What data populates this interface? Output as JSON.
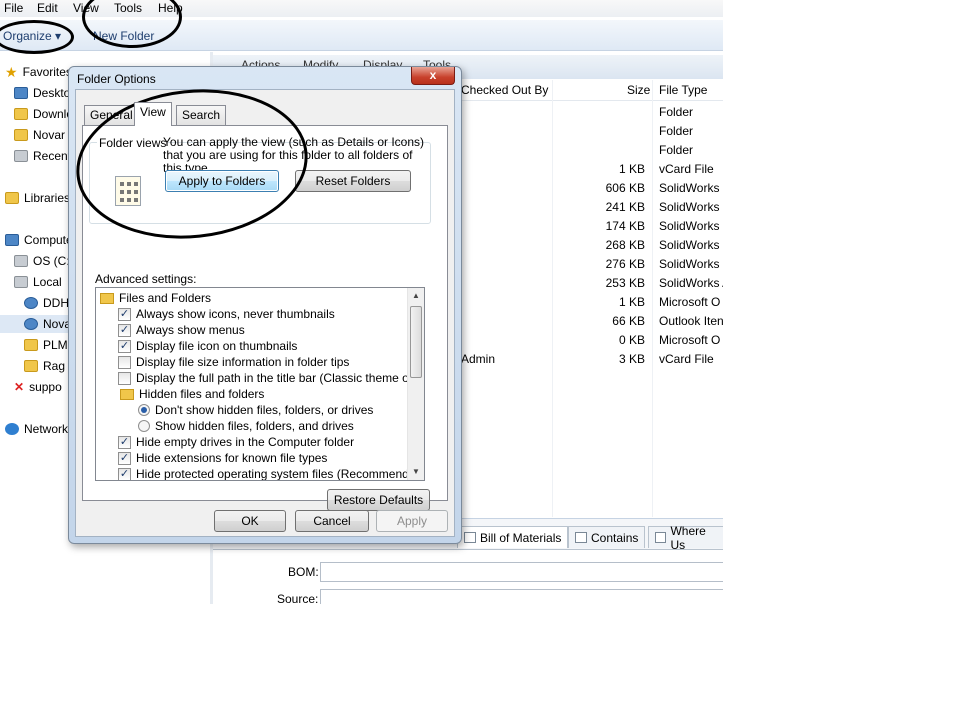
{
  "menubar": {
    "items": [
      "File",
      "Edit",
      "View",
      "Tools",
      "Help"
    ]
  },
  "cmdbar": {
    "organize": "Organize",
    "new_folder": "New Folder"
  },
  "toolbar2": {
    "items": [
      "Actions",
      "Modify",
      "Display",
      "Tools"
    ]
  },
  "navpane": {
    "items": [
      {
        "label": "Favorites",
        "icon": "star-icon"
      },
      {
        "label": "Desktop",
        "icon": "desktop-icon"
      },
      {
        "label": "Downloads",
        "icon": "folder-icon"
      },
      {
        "label": "Novar",
        "icon": "folder-icon"
      },
      {
        "label": "Recent",
        "icon": "recent-places-icon"
      },
      {
        "label": "Libraries",
        "icon": "library-icon"
      },
      {
        "label": "Computer",
        "icon": "computer-icon"
      },
      {
        "label": "OS (C:)",
        "icon": "drive-icon"
      },
      {
        "label": "Local",
        "icon": "drive-icon"
      },
      {
        "label": "DDH",
        "icon": "vault-icon"
      },
      {
        "label": "Nova",
        "icon": "vault-icon"
      },
      {
        "label": "PLM",
        "icon": "folder-icon"
      },
      {
        "label": "Rag",
        "icon": "folder-icon"
      },
      {
        "label": "suppo",
        "icon": "disconnected-drive-icon"
      },
      {
        "label": "Network",
        "icon": "network-icon"
      }
    ]
  },
  "filelist": {
    "headers": {
      "checked_out_by": "Checked Out By",
      "size": "Size",
      "file_type": "File Type"
    },
    "rows": [
      {
        "checked_out_by": "",
        "size": "",
        "file_type": "Folder"
      },
      {
        "checked_out_by": "",
        "size": "",
        "file_type": "Folder"
      },
      {
        "checked_out_by": "",
        "size": "",
        "file_type": "Folder"
      },
      {
        "checked_out_by": "",
        "size": "1 KB",
        "file_type": "vCard File"
      },
      {
        "checked_out_by": "",
        "size": "606 KB",
        "file_type": "SolidWorks I"
      },
      {
        "checked_out_by": "",
        "size": "241 KB",
        "file_type": "SolidWorks I"
      },
      {
        "checked_out_by": "",
        "size": "174 KB",
        "file_type": "SolidWorks I"
      },
      {
        "checked_out_by": "",
        "size": "268 KB",
        "file_type": "SolidWorks I"
      },
      {
        "checked_out_by": "",
        "size": "276 KB",
        "file_type": "SolidWorks I"
      },
      {
        "checked_out_by": "",
        "size": "253 KB",
        "file_type": "SolidWorks A"
      },
      {
        "checked_out_by": "",
        "size": "1 KB",
        "file_type": "Microsoft O"
      },
      {
        "checked_out_by": "",
        "size": "66 KB",
        "file_type": "Outlook Iten"
      },
      {
        "checked_out_by": "",
        "size": "0 KB",
        "file_type": "Microsoft O"
      },
      {
        "checked_out_by": "Admin",
        "size": "3 KB",
        "file_type": "vCard File"
      }
    ]
  },
  "bottompane": {
    "tabs": [
      "Bill of Materials",
      "Contains",
      "Where Us"
    ],
    "fields": {
      "bom": "BOM:",
      "source": "Source:"
    }
  },
  "dialog": {
    "title": "Folder Options",
    "close": "x",
    "tabs": [
      "General",
      "View",
      "Search"
    ],
    "folder_views": {
      "legend": "Folder views",
      "description": "You can apply the view (such as Details or Icons) that you are using for this folder to all folders of this type.",
      "apply": "Apply to Folders",
      "reset": "Reset Folders"
    },
    "advanced": {
      "label": "Advanced settings:",
      "items": [
        {
          "type": "folder",
          "label": "Files and Folders",
          "indent": 0
        },
        {
          "type": "check",
          "checked": true,
          "label": "Always show icons, never thumbnails",
          "indent": 1
        },
        {
          "type": "check",
          "checked": true,
          "label": "Always show menus",
          "indent": 1
        },
        {
          "type": "check",
          "checked": true,
          "label": "Display file icon on thumbnails",
          "indent": 1
        },
        {
          "type": "check",
          "checked": false,
          "label": "Display file size information in folder tips",
          "indent": 1
        },
        {
          "type": "check",
          "checked": false,
          "label": "Display the full path in the title bar (Classic theme only)",
          "indent": 1
        },
        {
          "type": "folder",
          "label": "Hidden files and folders",
          "indent": 1
        },
        {
          "type": "radio",
          "checked": true,
          "label": "Don't show hidden files, folders, or drives",
          "indent": 2
        },
        {
          "type": "radio",
          "checked": false,
          "label": "Show hidden files, folders, and drives",
          "indent": 2
        },
        {
          "type": "check",
          "checked": true,
          "label": "Hide empty drives in the Computer folder",
          "indent": 1
        },
        {
          "type": "check",
          "checked": true,
          "label": "Hide extensions for known file types",
          "indent": 1
        },
        {
          "type": "check",
          "checked": true,
          "label": "Hide protected operating system files (Recommended)",
          "indent": 1
        }
      ]
    },
    "restore": "Restore Defaults",
    "ok": "OK",
    "cancel": "Cancel",
    "apply": "Apply"
  }
}
